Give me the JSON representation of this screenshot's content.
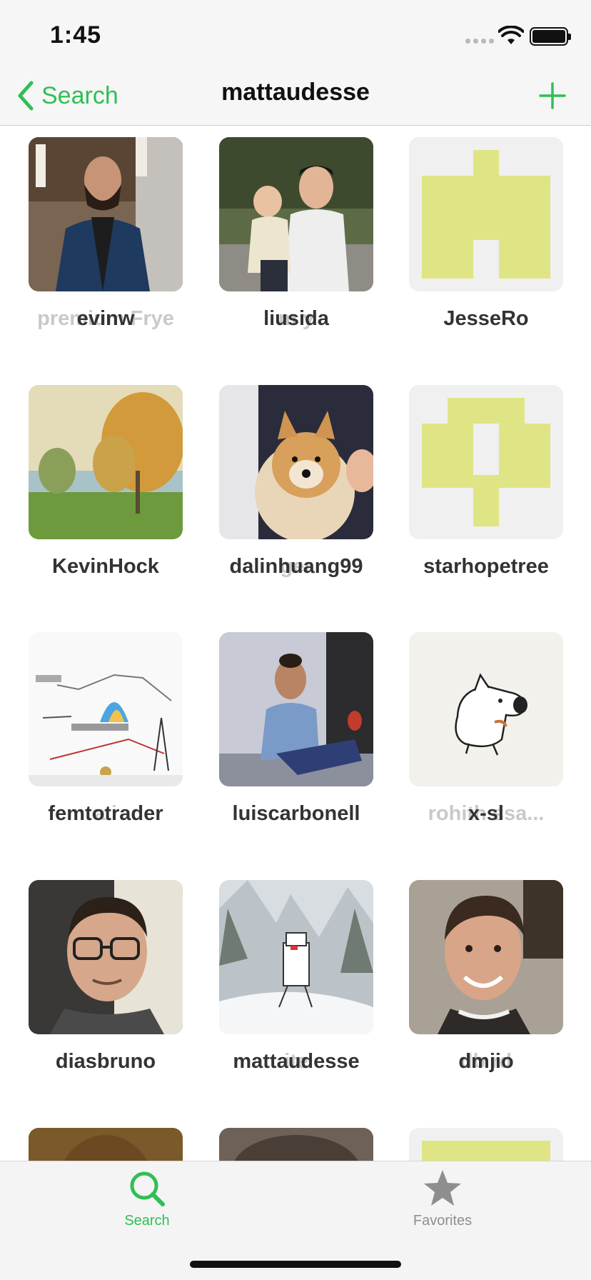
{
  "status_bar": {
    "time": "1:45"
  },
  "nav": {
    "back_label": "Search",
    "title": "mattaudesse"
  },
  "grid": {
    "items": [
      {
        "username": "evinw",
        "ghost": "premium Frye"
      },
      {
        "username": "liusida",
        "ghost": "m            y"
      },
      {
        "username": "JesseRo",
        "ghost": ""
      },
      {
        "username": "KevinHock",
        "ghost": ""
      },
      {
        "username": "dalinhuang99",
        "ghost": "ger"
      },
      {
        "username": "starhopetree",
        "ghost": ""
      },
      {
        "username": "femtotrader",
        "ghost": "a                    i"
      },
      {
        "username": "luiscarbonell",
        "ghost": ""
      },
      {
        "username": "x-sl",
        "ghost": "rohith          ssa..."
      },
      {
        "username": "diasbruno",
        "ghost": ""
      },
      {
        "username": "mattaudesse",
        "ghost": "                      ite"
      },
      {
        "username": "dmjio",
        "ghost": "db              rd"
      }
    ]
  },
  "tabs": [
    {
      "label": "Search",
      "icon": "search-icon"
    },
    {
      "label": "Favorites",
      "icon": "star-icon"
    }
  ],
  "colors": {
    "accent": "#2fbf55",
    "identicon": "#dfe584",
    "inactive": "#8e8e8e"
  }
}
